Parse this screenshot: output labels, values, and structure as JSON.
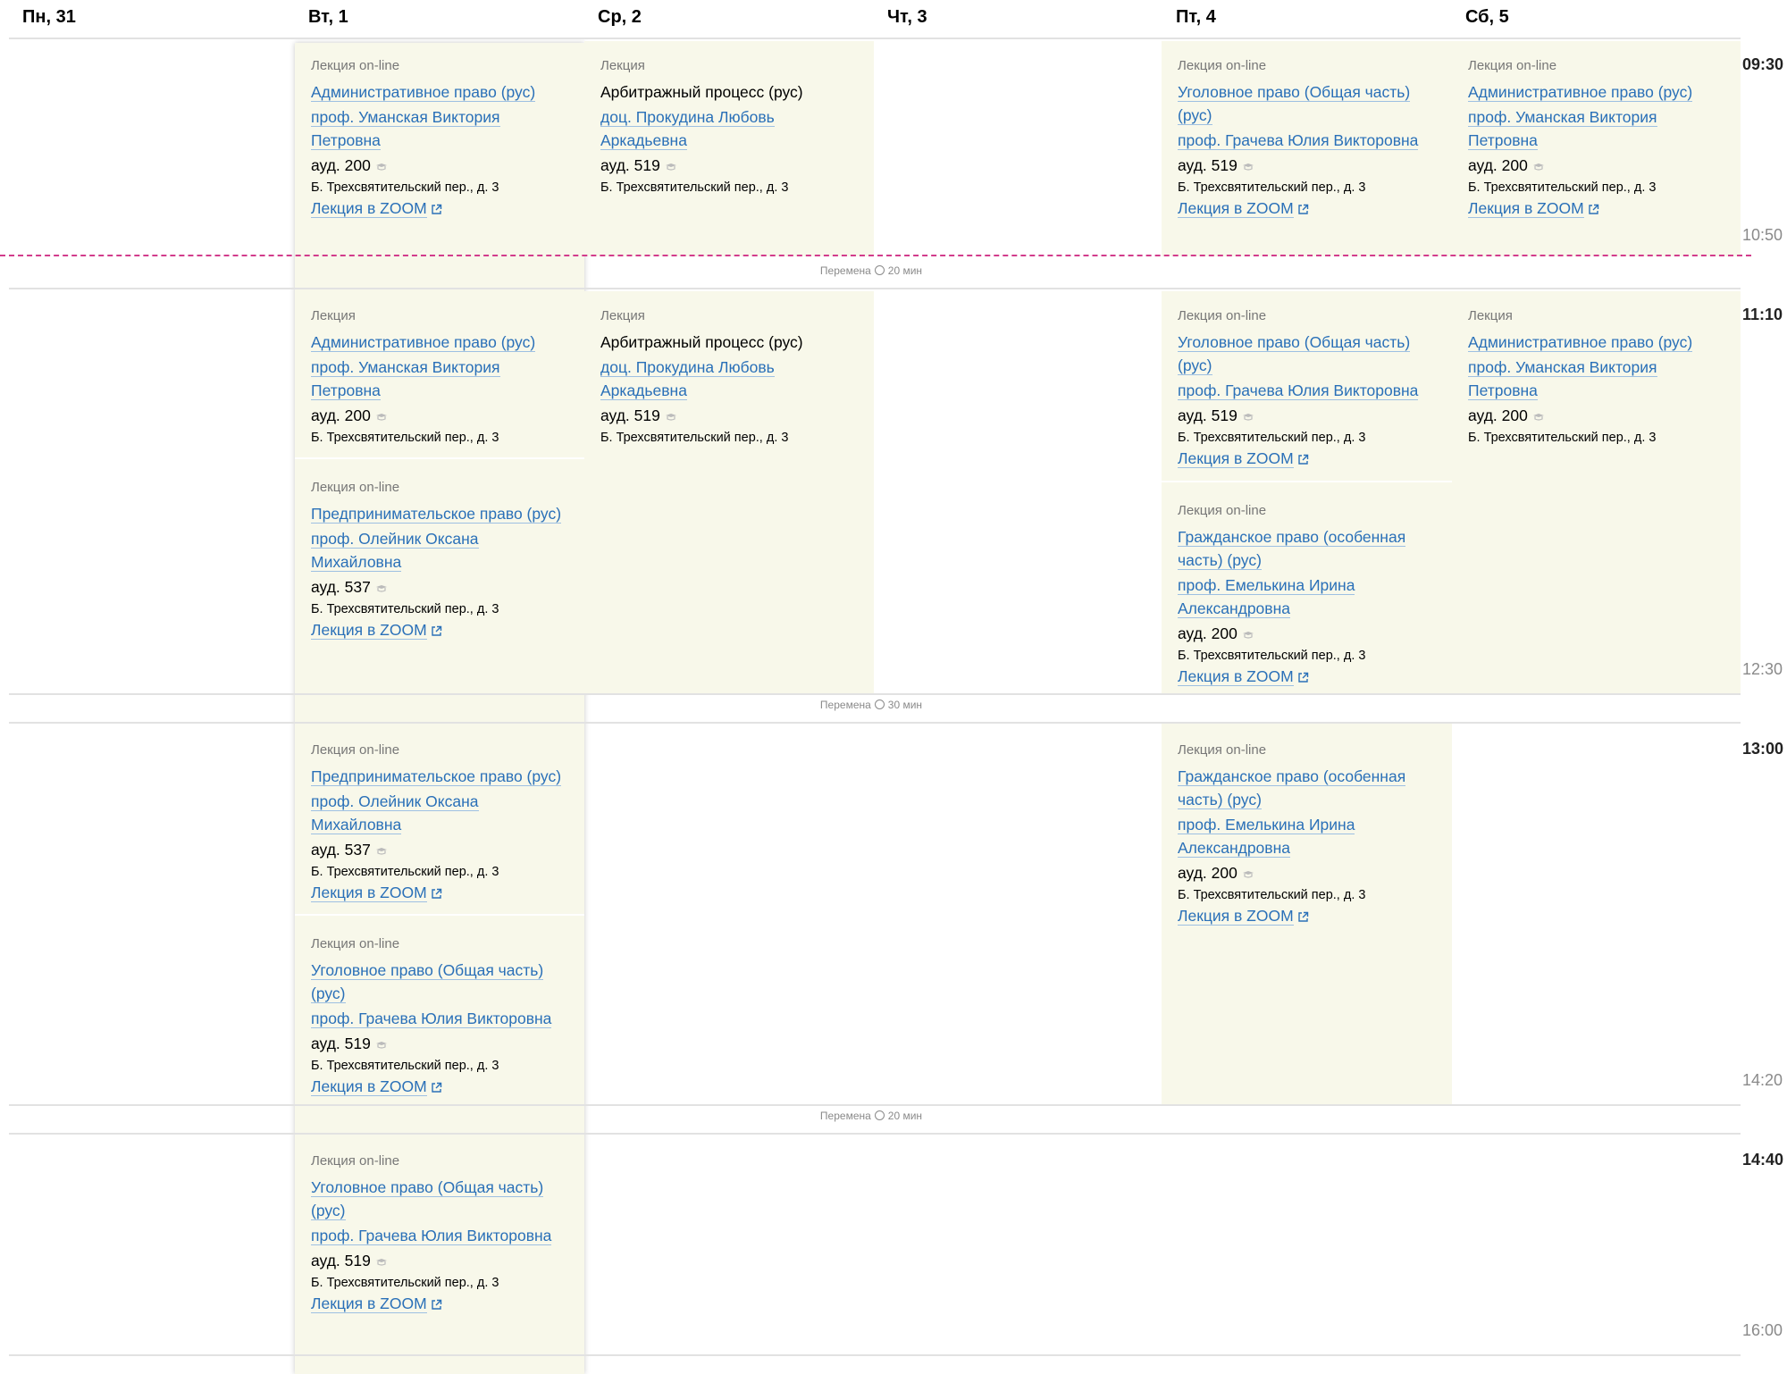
{
  "days": [
    "Пн, 31",
    "Вт, 1",
    "Ср, 2",
    "Чт, 3",
    "Пт, 4",
    "Сб, 5"
  ],
  "slots": [
    {
      "start": "09:30",
      "end": "10:50"
    },
    {
      "start": "11:10",
      "end": "12:30"
    },
    {
      "start": "13:00",
      "end": "14:20"
    },
    {
      "start": "14:40",
      "end": "16:00"
    }
  ],
  "breaks": [
    {
      "label": "Перемена",
      "duration": "20 мин"
    },
    {
      "label": "Перемена",
      "duration": "30 мин"
    },
    {
      "label": "Перемена",
      "duration": "20 мин"
    }
  ],
  "lessons": {
    "tue_1": {
      "type": "Лекция on-line",
      "subject": "Административное право (рус)",
      "teacher": "проф. Уманская Виктория Петровна",
      "room": "ауд. 200",
      "address": "Б. Трехсвятительский пер., д. 3",
      "zoom": "Лекция в ZOOM"
    },
    "wed_1": {
      "type": "Лекция",
      "subject": "Арбитражный процесс (рус)",
      "teacher": "доц. Прокудина Любовь Аркадьевна",
      "room": "ауд. 519",
      "address": "Б. Трехсвятительский пер., д. 3"
    },
    "fri_1": {
      "type": "Лекция on-line",
      "subject": "Уголовное право (Общая часть) (рус)",
      "teacher": "проф. Грачева Юлия Викторовна",
      "room": "ауд. 519",
      "address": "Б. Трехсвятительский пер., д. 3",
      "zoom": "Лекция в ZOOM"
    },
    "sat_1": {
      "type": "Лекция on-line",
      "subject": "Административное право (рус)",
      "teacher": "проф. Уманская Виктория Петровна",
      "room": "ауд. 200",
      "address": "Б. Трехсвятительский пер., д. 3",
      "zoom": "Лекция в ZOOM"
    },
    "tue_2a": {
      "type": "Лекция",
      "subject": "Административное право (рус)",
      "teacher": "проф. Уманская Виктория Петровна",
      "room": "ауд. 200",
      "address": "Б. Трехсвятительский пер., д. 3"
    },
    "tue_2b": {
      "type": "Лекция on-line",
      "subject": "Предпринимательское право (рус)",
      "teacher": "проф. Олейник Оксана Михайловна",
      "room": "ауд. 537",
      "address": "Б. Трехсвятительский пер., д. 3",
      "zoom": "Лекция в ZOOM"
    },
    "wed_2": {
      "type": "Лекция",
      "subject": "Арбитражный процесс (рус)",
      "teacher": "доц. Прокудина Любовь Аркадьевна",
      "room": "ауд. 519",
      "address": "Б. Трехсвятительский пер., д. 3"
    },
    "fri_2a": {
      "type": "Лекция on-line",
      "subject": "Уголовное право (Общая часть) (рус)",
      "teacher": "проф. Грачева Юлия Викторовна",
      "room": "ауд. 519",
      "address": "Б. Трехсвятительский пер., д. 3",
      "zoom": "Лекция в ZOOM"
    },
    "fri_2b": {
      "type": "Лекция on-line",
      "subject": "Гражданское право (особенная часть) (рус)",
      "teacher": "проф. Емелькина Ирина Александровна",
      "room": "ауд. 200",
      "address": "Б. Трехсвятительский пер., д. 3",
      "zoom": "Лекция в ZOOM"
    },
    "sat_2": {
      "type": "Лекция",
      "subject": "Административное право (рус)",
      "teacher": "проф. Уманская Виктория Петровна",
      "room": "ауд. 200",
      "address": "Б. Трехсвятительский пер., д. 3"
    },
    "tue_3a": {
      "type": "Лекция on-line",
      "subject": "Предпринимательское право (рус)",
      "teacher": "проф. Олейник Оксана Михайловна",
      "room": "ауд. 537",
      "address": "Б. Трехсвятительский пер., д. 3",
      "zoom": "Лекция в ZOOM"
    },
    "tue_3b": {
      "type": "Лекция on-line",
      "subject": "Уголовное право (Общая часть) (рус)",
      "teacher": "проф. Грачева Юлия Викторовна",
      "room": "ауд. 519",
      "address": "Б. Трехсвятительский пер., д. 3",
      "zoom": "Лекция в ZOOM"
    },
    "fri_3": {
      "type": "Лекция on-line",
      "subject": "Гражданское право (особенная часть) (рус)",
      "teacher": "проф. Емелькина Ирина Александровна",
      "room": "ауд. 200",
      "address": "Б. Трехсвятительский пер., д. 3",
      "zoom": "Лекция в ZOOM"
    },
    "tue_4": {
      "type": "Лекция on-line",
      "subject": "Уголовное право (Общая часть) (рус)",
      "teacher": "проф. Грачева Юлия Викторовна",
      "room": "ауд. 519",
      "address": "Б. Трехсвятительский пер., д. 3",
      "zoom": "Лекция в ZOOM"
    }
  },
  "colors": {
    "card_bg": "#f8f8ea",
    "link": "#2a70b8",
    "now_line": "#d23c8c"
  }
}
